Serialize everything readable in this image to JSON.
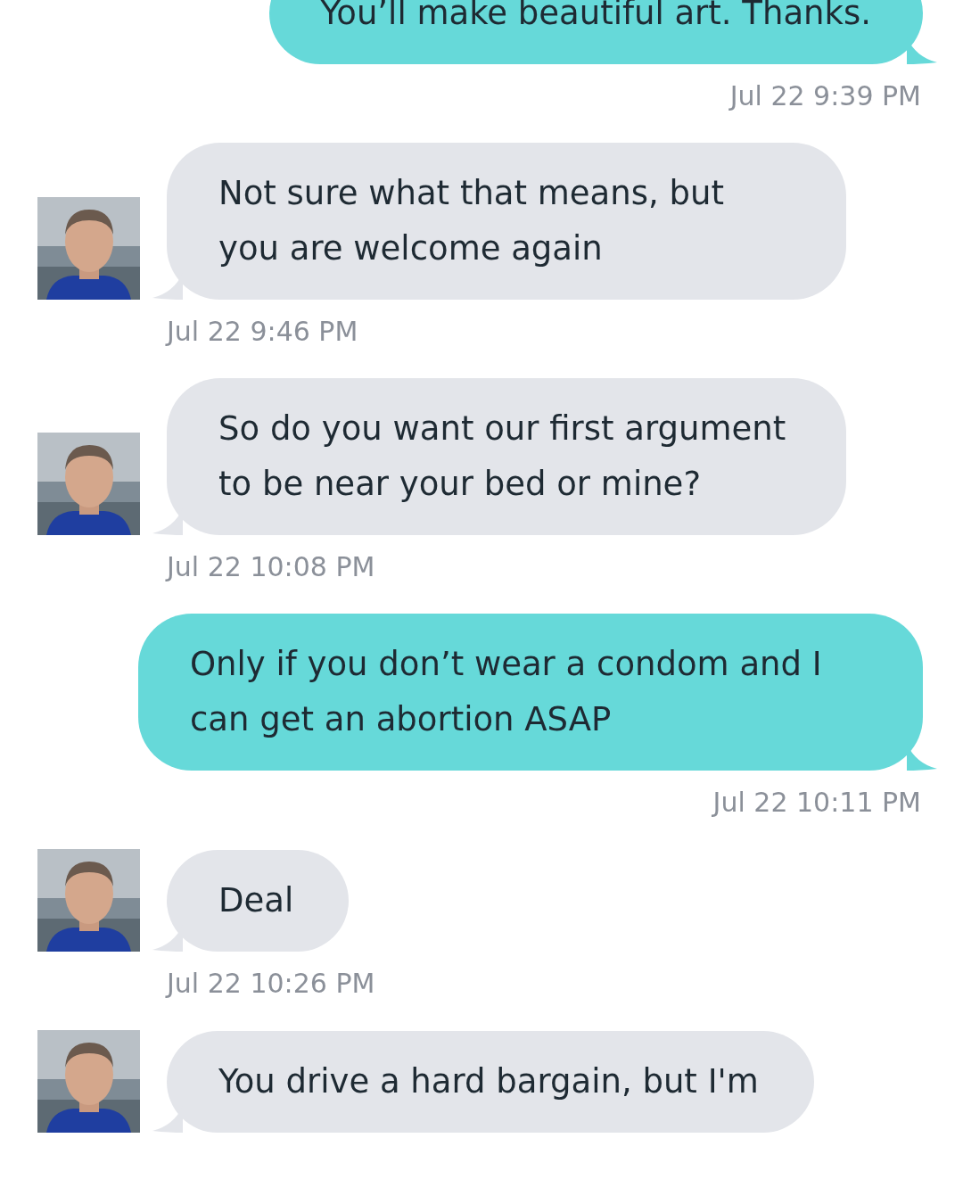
{
  "messages": [
    {
      "kind": "sent",
      "text": "You’ll make beautiful art. Thanks.",
      "time": "Jul 22 9:39 PM"
    },
    {
      "kind": "received",
      "text": "Not sure what that means, but you are welcome again",
      "time": "Jul 22 9:46 PM"
    },
    {
      "kind": "received",
      "text": "So do you want our first argument to be near your bed or mine?",
      "time": "Jul 22 10:08 PM"
    },
    {
      "kind": "sent",
      "text": "Only if you don’t wear a condom and I can get an abortion ASAP",
      "time": "Jul 22 10:11 PM"
    },
    {
      "kind": "received",
      "text": "Deal",
      "time": "Jul 22 10:26 PM"
    },
    {
      "kind": "received",
      "text": "You drive a hard bargain, but I'm"
    }
  ]
}
